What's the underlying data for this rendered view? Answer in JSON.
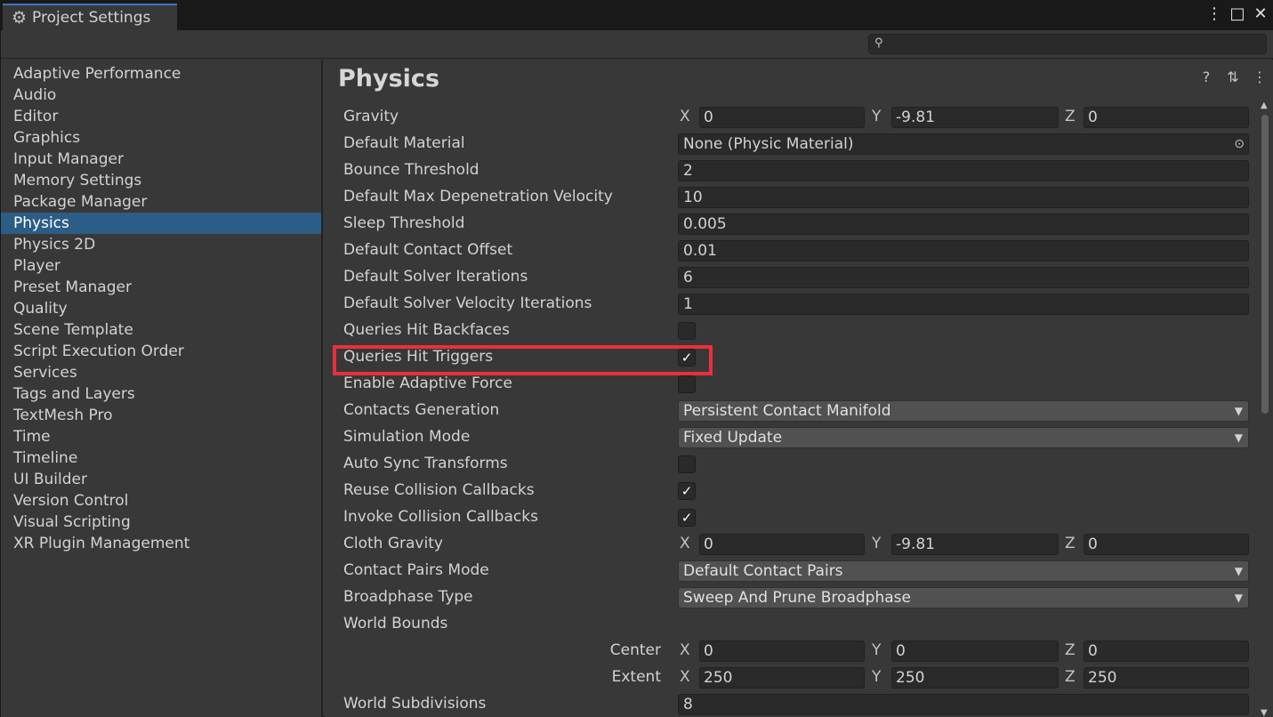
{
  "window": {
    "tab_title": "Project Settings"
  },
  "search": {
    "placeholder": ""
  },
  "sidebar": {
    "items": [
      "Adaptive Performance",
      "Audio",
      "Editor",
      "Graphics",
      "Input Manager",
      "Memory Settings",
      "Package Manager",
      "Physics",
      "Physics 2D",
      "Player",
      "Preset Manager",
      "Quality",
      "Scene Template",
      "Script Execution Order",
      "Services",
      "Tags and Layers",
      "TextMesh Pro",
      "Time",
      "Timeline",
      "UI Builder",
      "Version Control",
      "Visual Scripting",
      "XR Plugin Management"
    ],
    "selected": "Physics"
  },
  "header": {
    "title": "Physics"
  },
  "axes": {
    "x": "X",
    "y": "Y",
    "z": "Z"
  },
  "settings": {
    "gravity": {
      "label": "Gravity",
      "x": "0",
      "y": "-9.81",
      "z": "0"
    },
    "default_material": {
      "label": "Default Material",
      "value": "None (Physic Material)"
    },
    "bounce_threshold": {
      "label": "Bounce Threshold",
      "value": "2"
    },
    "max_depenetration": {
      "label": "Default Max Depenetration Velocity",
      "value": "10"
    },
    "sleep_threshold": {
      "label": "Sleep Threshold",
      "value": "0.005"
    },
    "contact_offset": {
      "label": "Default Contact Offset",
      "value": "0.01"
    },
    "solver_iterations": {
      "label": "Default Solver Iterations",
      "value": "6"
    },
    "solver_velocity_iterations": {
      "label": "Default Solver Velocity Iterations",
      "value": "1"
    },
    "queries_hit_backfaces": {
      "label": "Queries Hit Backfaces",
      "checked": false
    },
    "queries_hit_triggers": {
      "label": "Queries Hit Triggers",
      "checked": true
    },
    "enable_adaptive_force": {
      "label": "Enable Adaptive Force",
      "checked": false
    },
    "contacts_generation": {
      "label": "Contacts Generation",
      "value": "Persistent Contact Manifold"
    },
    "simulation_mode": {
      "label": "Simulation Mode",
      "value": "Fixed Update"
    },
    "auto_sync_transforms": {
      "label": "Auto Sync Transforms",
      "checked": false
    },
    "reuse_collision_callbacks": {
      "label": "Reuse Collision Callbacks",
      "checked": true
    },
    "invoke_collision_callbacks": {
      "label": "Invoke Collision Callbacks",
      "checked": true
    },
    "cloth_gravity": {
      "label": "Cloth Gravity",
      "x": "0",
      "y": "-9.81",
      "z": "0"
    },
    "contact_pairs_mode": {
      "label": "Contact Pairs Mode",
      "value": "Default Contact Pairs"
    },
    "broadphase_type": {
      "label": "Broadphase Type",
      "value": "Sweep And Prune Broadphase"
    },
    "world_bounds": {
      "label": "World Bounds",
      "center": {
        "label": "Center",
        "x": "0",
        "y": "0",
        "z": "0"
      },
      "extent": {
        "label": "Extent",
        "x": "250",
        "y": "250",
        "z": "250"
      }
    },
    "world_subdivisions": {
      "label": "World Subdivisions",
      "value": "8"
    }
  },
  "icons": {
    "gear": "⚙",
    "search": "🔍",
    "kebab": "⋮",
    "maximize": "□",
    "close": "✕",
    "help": "?",
    "preset": "⇅",
    "check": "✓",
    "caret": "▼",
    "target": "⊙"
  }
}
